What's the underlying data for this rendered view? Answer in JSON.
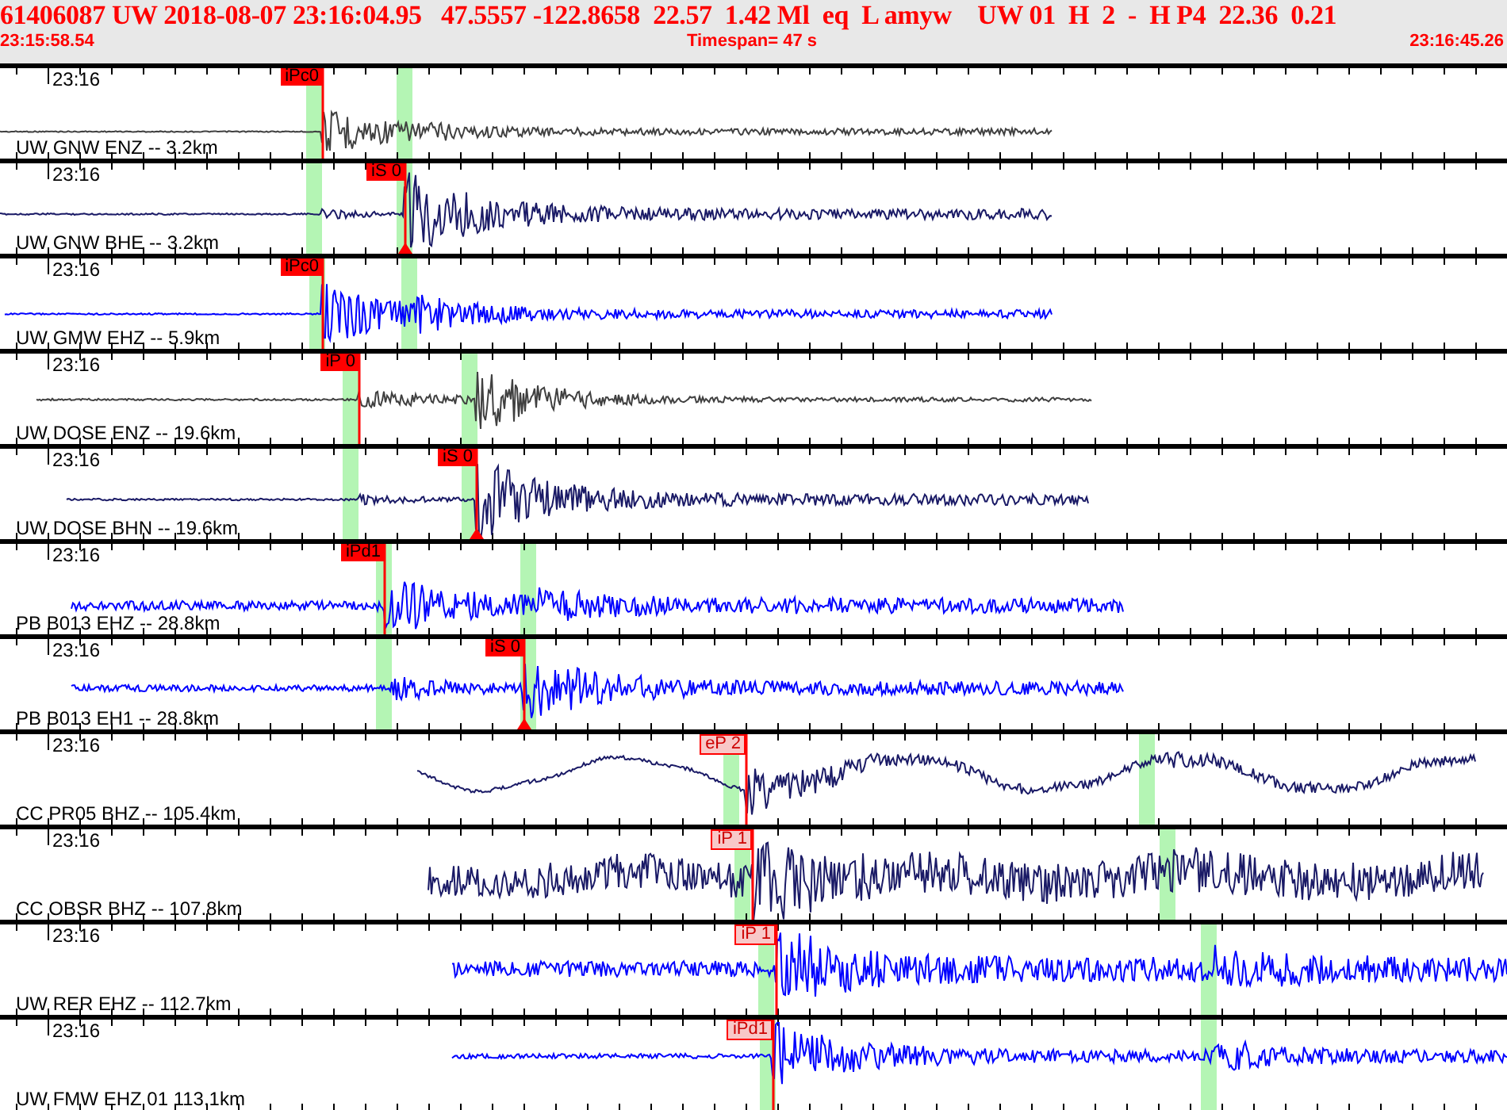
{
  "header": {
    "title": "61406087 UW 2018-08-07 23:16:04.95   47.5557 -122.8658  22.57  1.42 Ml  eq  L amyw    UW 01  H  2  -  H P4  22.36  0.21",
    "start_time": "23:15:58.54",
    "timespan": "Timespan=  47 s",
    "end_time": "23:16:45.26"
  },
  "traces": [
    {
      "time_label": "23:16",
      "station": "UW GNW ENZ -- 3.2km",
      "color": "#404040",
      "pick": {
        "label": "iPc0",
        "kind": "filled"
      }
    },
    {
      "time_label": "23:16",
      "station": "UW GNW BHE -- 3.2km",
      "color": "#1a1a66",
      "pick": {
        "label": "iS 0",
        "kind": "filled"
      }
    },
    {
      "time_label": "23:16",
      "station": "UW GMW EHZ -- 5.9km",
      "color": "#0000ff",
      "pick": {
        "label": "iPc0",
        "kind": "filled"
      }
    },
    {
      "time_label": "23:16",
      "station": "UW DOSE ENZ -- 19.6km",
      "color": "#404040",
      "pick": {
        "label": "iP 0",
        "kind": "filled"
      }
    },
    {
      "time_label": "23:16",
      "station": "UW DOSE BHN -- 19.6km",
      "color": "#1a1a66",
      "pick": {
        "label": "iS 0",
        "kind": "filled"
      }
    },
    {
      "time_label": "23:16",
      "station": "PB B013 EHZ -- 28.8km",
      "color": "#0000ff",
      "pick": {
        "label": "iPd1",
        "kind": "filled"
      }
    },
    {
      "time_label": "23:16",
      "station": "PB B013 EH1 -- 28.8km",
      "color": "#0000ff",
      "pick": {
        "label": "iS 0",
        "kind": "filled"
      }
    },
    {
      "time_label": "23:16",
      "station": "CC PR05 BHZ -- 105.4km",
      "color": "#1a1a66",
      "pick": {
        "label": "eP 2",
        "kind": "outlined"
      }
    },
    {
      "time_label": "23:16",
      "station": "CC OBSR BHZ -- 107.8km",
      "color": "#1a1a66",
      "pick": {
        "label": "iP 1",
        "kind": "outlined"
      }
    },
    {
      "time_label": "23:16",
      "station": "UW RER EHZ -- 112.7km",
      "color": "#0000ff",
      "pick": {
        "label": "iP 1",
        "kind": "outlined"
      }
    },
    {
      "time_label": "23:16",
      "station": "UW FMW EHZ 01 113.1km",
      "color": "#0000ff",
      "pick": {
        "label": "iPd1",
        "kind": "outlined"
      }
    }
  ]
}
